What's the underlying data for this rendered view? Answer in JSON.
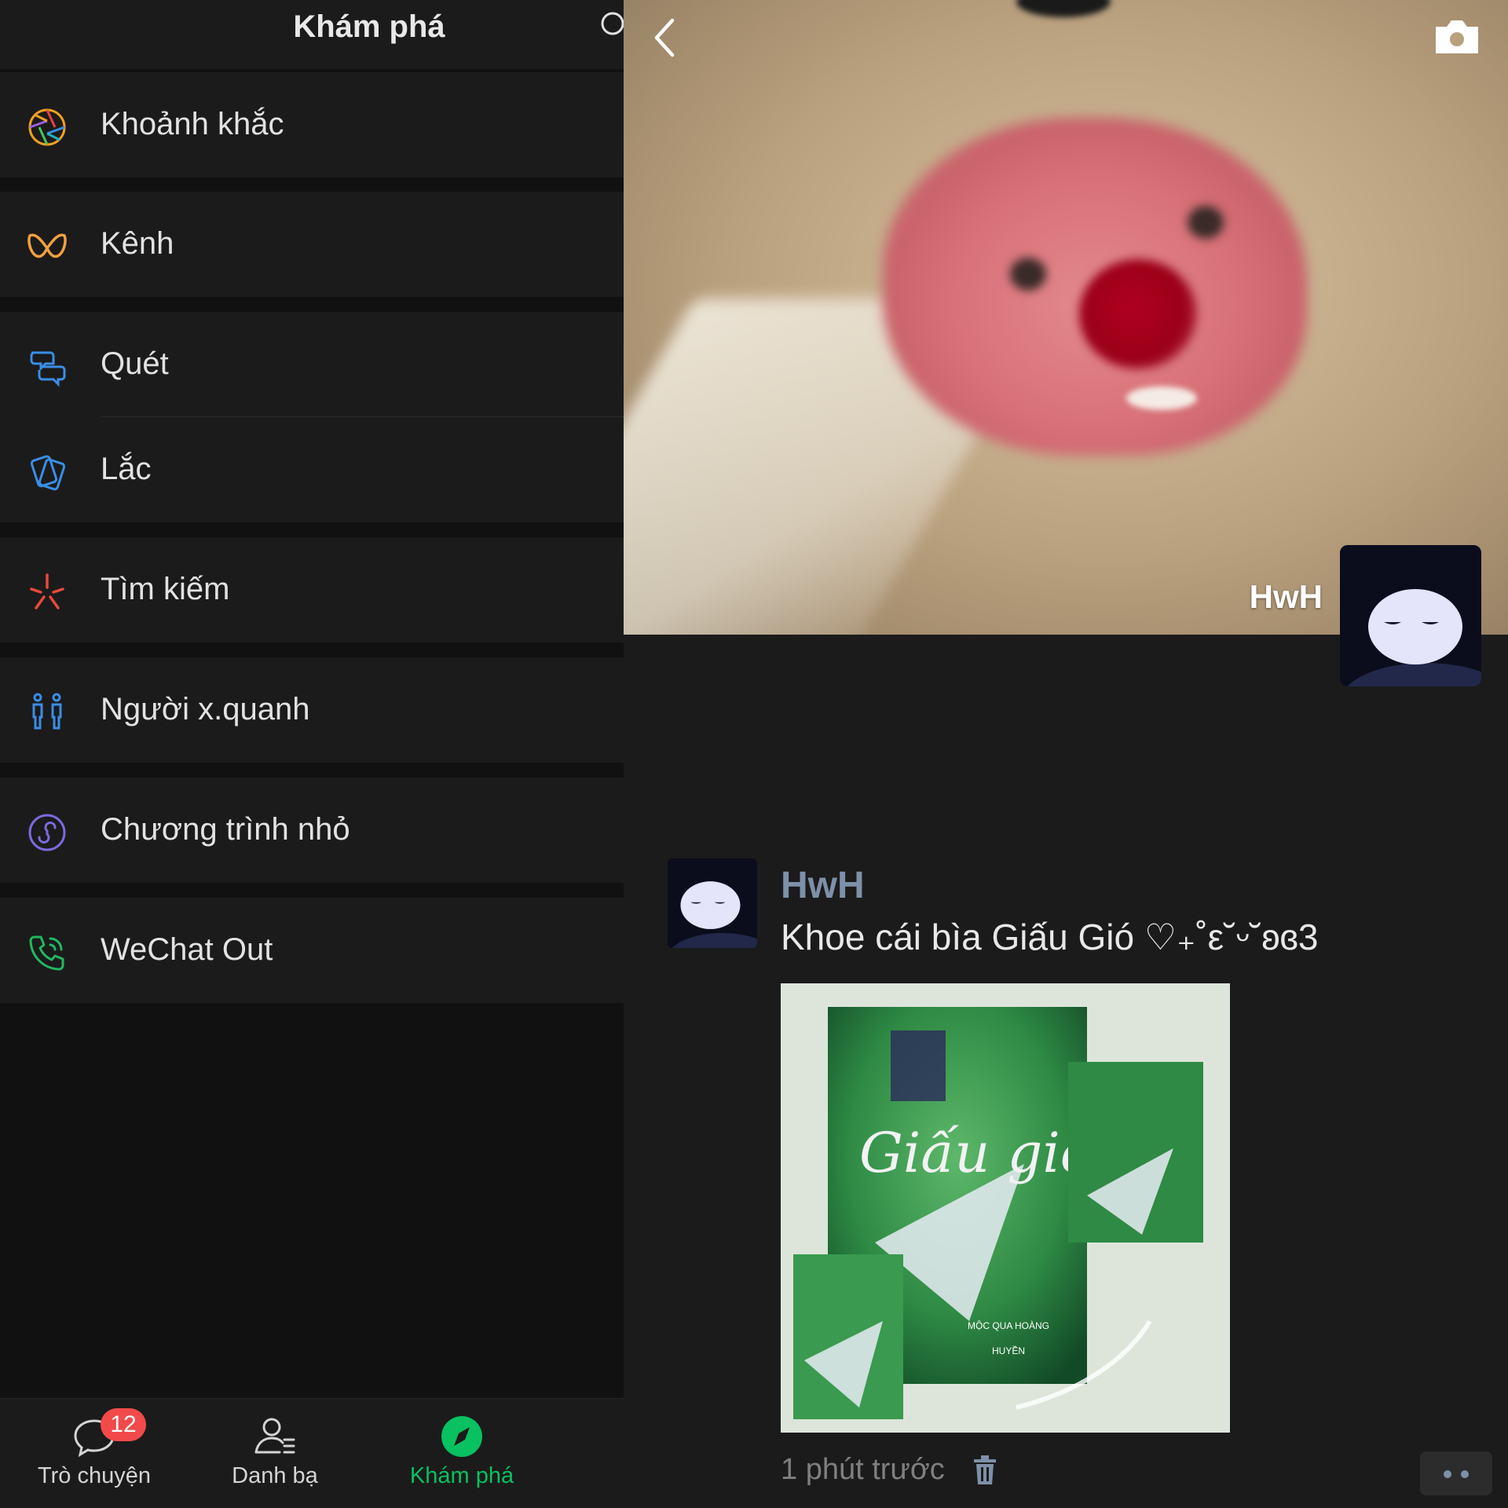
{
  "discover": {
    "title": "Khám phá",
    "items": [
      {
        "label": "Khoảnh khắc",
        "icon": "moments-icon"
      },
      {
        "label": "Kênh",
        "icon": "channels-icon"
      },
      {
        "label": "Quét",
        "icon": "scan-icon"
      },
      {
        "label": "Lắc",
        "icon": "shake-icon"
      },
      {
        "label": "Tìm kiếm",
        "icon": "search-spark-icon"
      },
      {
        "label": "Người x.quanh",
        "icon": "people-nearby-icon"
      },
      {
        "label": "Chương trình nhỏ",
        "icon": "mini-programs-icon"
      },
      {
        "label": "WeChat Out",
        "icon": "phone-icon"
      }
    ]
  },
  "tabbar": {
    "tabs": [
      {
        "label": "Trò chuyện",
        "icon": "chat-icon",
        "badge": "12"
      },
      {
        "label": "Danh bạ",
        "icon": "contacts-icon"
      },
      {
        "label": "Khám phá",
        "icon": "discover-compass-icon",
        "active": true
      }
    ]
  },
  "moments": {
    "cover_name": "HwH",
    "post": {
      "author": "HwH",
      "text": "Khoe cái bìa Giấu Gió ♡₊˚ε˘ᵕ˘ʚɞ3",
      "image_text": {
        "title": "Giấu gió",
        "author_line": "MỘC QUA HOÀNG",
        "artist_line": "HUYỀN"
      },
      "time": "1 phút trước"
    }
  },
  "colors": {
    "accent_green": "#08c160",
    "badge_red": "#f24a4a",
    "name_blue": "#7d90a9"
  }
}
